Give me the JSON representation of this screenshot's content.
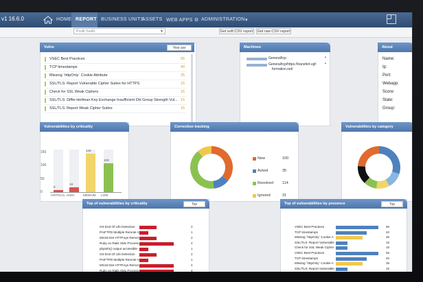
{
  "app": {
    "version": "v1 16.6.0"
  },
  "nav": {
    "items": [
      "HOME",
      "REPORT",
      "BUSINESS UNITS",
      "ASSETS",
      "WEB APPS ⚙",
      "ADMINISTRATION",
      "▾"
    ]
  },
  "toolbar": {
    "select_value": "Profil Swith",
    "btn_csv": "Get soft CSV report",
    "btn_csv2": "Get raw CSV report"
  },
  "vulns": {
    "title": "Vulns",
    "button": "Year par",
    "rows": [
      {
        "label": "VSEC Best Practices",
        "value": "55"
      },
      {
        "label": "TCP timestamps",
        "value": "40"
      },
      {
        "label": "Missing `httpOnly` Cookie Attribute",
        "value": "35"
      },
      {
        "label": "SSL/TLS: Report Vulnerable Cipher Suites for HTTPS",
        "value": "15"
      },
      {
        "label": "Check for SSL Weak Ciphers",
        "value": "15"
      },
      {
        "label": "SSL/TLS: Diffie-Hellman Key Exchange Insufficient DH Group Strength Vul...",
        "value": "15"
      },
      {
        "label": "SSL/TLS: Report Weak Cipher Suites",
        "value": "15"
      }
    ]
  },
  "machines": {
    "title": "Machines",
    "rows": [
      "General/tcp",
      "General/tcp/https://transfert.vgf-",
      "formation.net/"
    ]
  },
  "about": {
    "title": "About",
    "labels": [
      "Name:",
      "Ip:",
      "Port:",
      "Webapp:",
      "Score:",
      "State:",
      "Group:"
    ]
  },
  "criticality": {
    "title": "Vulnerabilities by criticality",
    "chart_data": {
      "type": "bar",
      "categories": [
        "CRITICAL",
        "HIGH",
        "MEDIUM",
        "LOW"
      ],
      "values": [
        8,
        18,
        145,
        108
      ],
      "colors": [
        "#d9534f",
        "#d9534f",
        "#f1d56b",
        "#8cc152"
      ],
      "yticks": [
        0,
        50,
        100,
        150
      ],
      "ylim": [
        0,
        160
      ]
    }
  },
  "tracking": {
    "title": "Correction tracking",
    "chart_data": {
      "type": "pie",
      "labels": [
        "New",
        "Acked",
        "Resolved",
        "Ignored"
      ],
      "values": [
        100,
        35,
        114,
        31
      ],
      "colors": [
        "#e06a2f",
        "#4f81bd",
        "#8cc152",
        "#f1c84b"
      ]
    }
  },
  "category": {
    "title": "Vulnerabilities by category",
    "chart_data": {
      "type": "pie",
      "values": [
        30,
        12,
        10,
        10,
        14,
        24
      ],
      "colors": [
        "#4f81bd",
        "#8ab6e0",
        "#f1d56b",
        "#8cc152",
        "#111111",
        "#e06a2f"
      ]
    }
  },
  "top_crit": {
    "title": "Top of vulnerabilities by criticality",
    "button": "Top",
    "chart_data": {
      "type": "bar",
      "labels": [
        "OS End Of Life Detection",
        "ProFTPD Multiple Remote V",
        "MS15-034 HTTP.sys Remot",
        "Ruby on Rails XML Process",
        "phpinfo() output accessible",
        "OS End Of Life Detection",
        "ProFTPD Multiple Remote V",
        "MS15-034 HTTP.sys Remot",
        "Ruby on Rails XML Process"
      ],
      "values": [
        2,
        1,
        2,
        4,
        1,
        2,
        1,
        4,
        4
      ],
      "color": "#c71f2d"
    }
  },
  "top_pres": {
    "title": "Top of vulnerabilities by presence",
    "button": "Top",
    "chart_data": {
      "type": "bar",
      "labels": [
        "VSEC Best Practices",
        "TCP timestamps",
        "Missing `httpOnly` Cookie A",
        "SSL/TLS: Report Vulnerable",
        "Check for SSL Weak Cipher",
        "VSEC Best Practices",
        "TCP timestamps",
        "Missing `httpOnly` Cookie A",
        "SSL/TLS: Report Vulnerable",
        "Check for SSL Weak Cipher"
      ],
      "values": [
        55,
        40,
        35,
        15,
        15,
        55,
        40,
        35,
        15,
        15
      ],
      "colors": [
        "#4f81bd",
        "#4f81bd",
        "#f1c84b",
        "#4f81bd",
        "#4f81bd",
        "#4f81bd",
        "#4f81bd",
        "#f1c84b",
        "#4f81bd",
        "#4f81bd"
      ]
    }
  }
}
